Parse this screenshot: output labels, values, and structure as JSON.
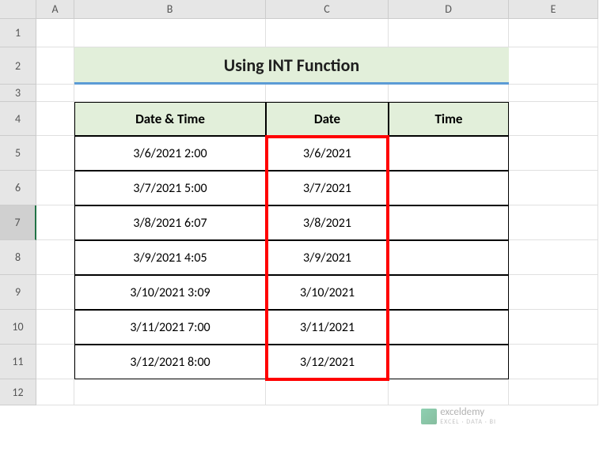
{
  "columns": [
    "",
    "A",
    "B",
    "C",
    "D",
    "E"
  ],
  "rows": [
    "1",
    "2",
    "3",
    "4",
    "5",
    "6",
    "7",
    "8",
    "9",
    "10",
    "11",
    "12"
  ],
  "title": "Using INT Function",
  "headers": {
    "col_b": "Date & Time",
    "col_c": "Date",
    "col_d": "Time"
  },
  "data": [
    {
      "datetime": "3/6/2021 2:00",
      "date": "3/6/2021",
      "time": ""
    },
    {
      "datetime": "3/7/2021 5:00",
      "date": "3/7/2021",
      "time": ""
    },
    {
      "datetime": "3/8/2021 6:07",
      "date": "3/8/2021",
      "time": ""
    },
    {
      "datetime": "3/9/2021 4:05",
      "date": "3/9/2021",
      "time": ""
    },
    {
      "datetime": "3/10/2021 3:09",
      "date": "3/10/2021",
      "time": ""
    },
    {
      "datetime": "3/11/2021 7:00",
      "date": "3/11/2021",
      "time": ""
    },
    {
      "datetime": "3/12/2021 8:00",
      "date": "3/12/2021",
      "time": ""
    }
  ],
  "watermark": {
    "name": "exceldemy",
    "tagline": "EXCEL · DATA · BI"
  },
  "selected_row": "7"
}
